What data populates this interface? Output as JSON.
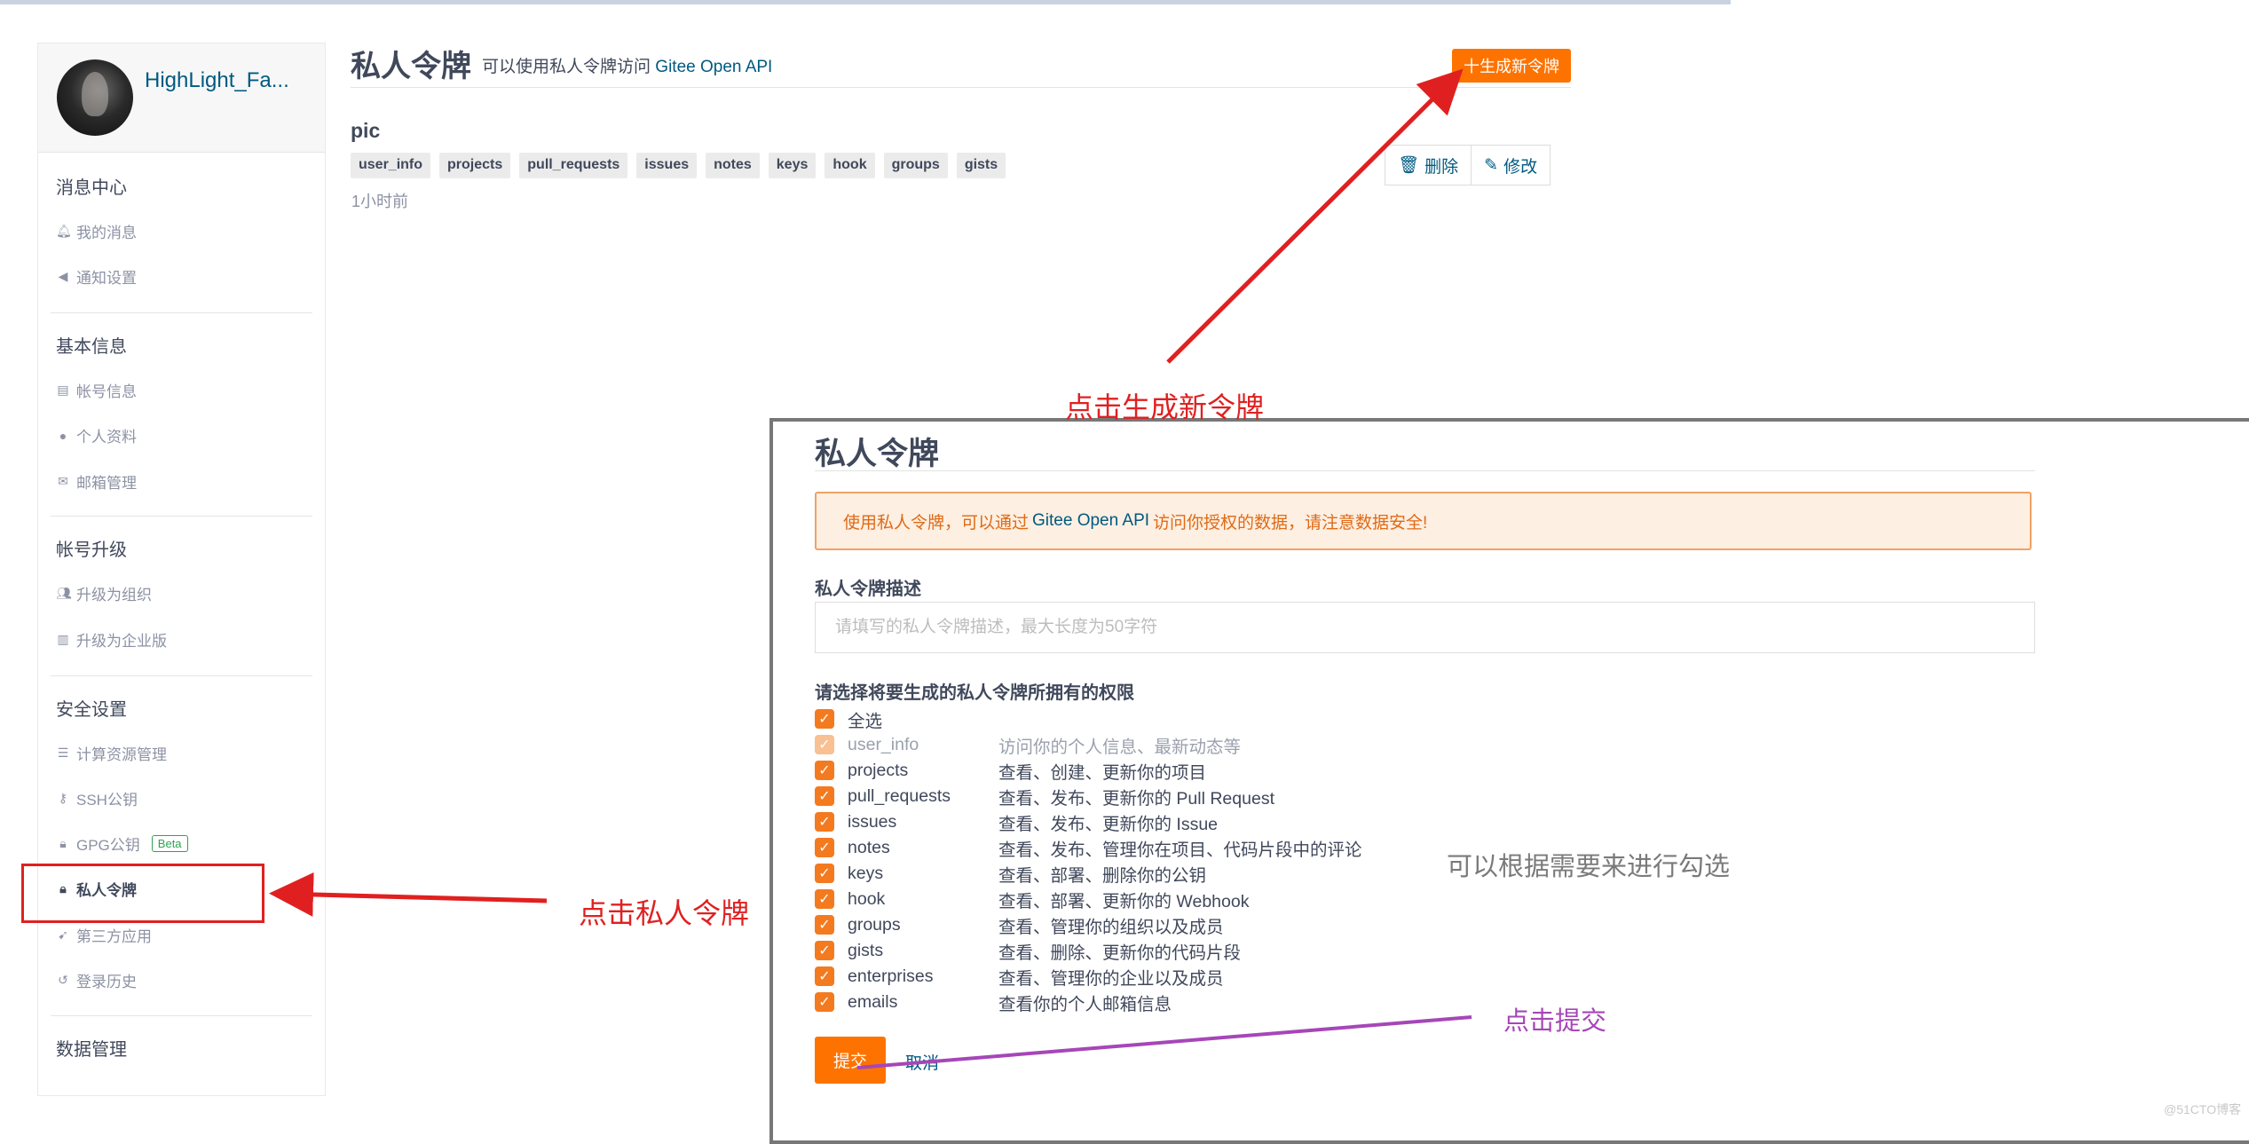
{
  "sidebar": {
    "username": "HighLight_Fa...",
    "sections": [
      {
        "title": "消息中心",
        "items": [
          {
            "label": "我的消息",
            "icon": "bell-icon"
          },
          {
            "label": "通知设置",
            "icon": "speaker-icon"
          }
        ]
      },
      {
        "title": "基本信息",
        "items": [
          {
            "label": "帐号信息",
            "icon": "id-card-icon"
          },
          {
            "label": "个人资料",
            "icon": "user-icon"
          },
          {
            "label": "邮箱管理",
            "icon": "envelope-icon"
          }
        ]
      },
      {
        "title": "帐号升级",
        "items": [
          {
            "label": "升级为组织",
            "icon": "users-icon"
          },
          {
            "label": "升级为企业版",
            "icon": "building-icon"
          }
        ]
      },
      {
        "title": "安全设置",
        "items": [
          {
            "label": "计算资源管理",
            "icon": "list-icon"
          },
          {
            "label": "SSH公钥",
            "icon": "key-icon"
          },
          {
            "label": "GPG公钥",
            "icon": "lock-icon",
            "badge": "Beta"
          },
          {
            "label": "私人令牌",
            "icon": "token-icon",
            "active": true
          },
          {
            "label": "第三方应用",
            "icon": "rocket-icon"
          },
          {
            "label": "登录历史",
            "icon": "history-icon"
          }
        ]
      },
      {
        "title": "数据管理",
        "items": []
      }
    ]
  },
  "header": {
    "title": "私人令牌",
    "subtitle_prefix": "可以使用私人令牌访问",
    "subtitle_api": "Gitee Open API",
    "generate_button": "十生成新令牌"
  },
  "token": {
    "name": "pic",
    "scopes": [
      "user_info",
      "projects",
      "pull_requests",
      "issues",
      "notes",
      "keys",
      "hook",
      "groups",
      "gists"
    ],
    "created": "1小时前",
    "delete_label": "删除",
    "edit_label": "修改"
  },
  "annotations": {
    "click_generate": "点击生成新令牌",
    "click_token": "点击私人令牌",
    "choose_as_needed": "可以根据需要来进行勾选",
    "click_submit": "点击提交",
    "arrow_color": "#e02020",
    "purple_color": "#a646b8"
  },
  "form": {
    "title": "私人令牌",
    "alert_prefix": "使用私人令牌，可以通过",
    "alert_api": "Gitee Open API",
    "alert_suffix": "访问你授权的数据，请注意数据安全!",
    "desc_label": "私人令牌描述",
    "desc_placeholder": "请填写的私人令牌描述，最大长度为50字符",
    "perm_label": "请选择将要生成的私人令牌所拥有的权限",
    "select_all": "全选",
    "permissions": [
      {
        "name": "user_info",
        "desc": "访问你的个人信息、最新动态等",
        "disabled": true
      },
      {
        "name": "projects",
        "desc": "查看、创建、更新你的项目"
      },
      {
        "name": "pull_requests",
        "desc": "查看、发布、更新你的 Pull Request"
      },
      {
        "name": "issues",
        "desc": "查看、发布、更新你的 Issue"
      },
      {
        "name": "notes",
        "desc": "查看、发布、管理你在项目、代码片段中的评论"
      },
      {
        "name": "keys",
        "desc": "查看、部署、删除你的公钥"
      },
      {
        "name": "hook",
        "desc": "查看、部署、更新你的 Webhook"
      },
      {
        "name": "groups",
        "desc": "查看、管理你的组织以及成员"
      },
      {
        "name": "gists",
        "desc": "查看、删除、更新你的代码片段"
      },
      {
        "name": "enterprises",
        "desc": "查看、管理你的企业以及成员"
      },
      {
        "name": "emails",
        "desc": "查看你的个人邮箱信息"
      }
    ],
    "submit": "提交",
    "cancel": "取消"
  },
  "watermark": "@51CTO博客",
  "colors": {
    "brand_orange": "#fe7300",
    "link_blue": "#005980"
  }
}
